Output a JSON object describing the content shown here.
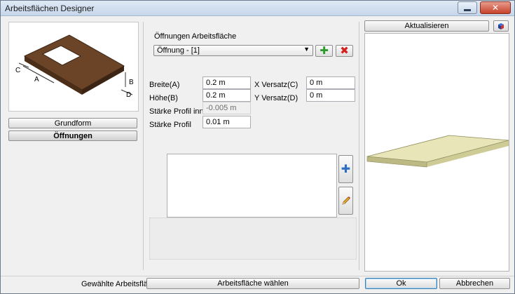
{
  "window": {
    "title": "Arbeitsflächen Designer"
  },
  "left": {
    "diagram_labels": {
      "a": "A",
      "b": "B",
      "c": "C",
      "d": "D"
    },
    "buttons": {
      "grundform": "Grundform",
      "oeffnungen": "Öffnungen"
    }
  },
  "openings": {
    "group_label": "Öffnungen Arbeitsfläche",
    "selected": "Öffnung - [1]"
  },
  "fields": {
    "breite_label": "Breite(A)",
    "breite_value": "0.2 m",
    "hoehe_label": "Höhe(B)",
    "hoehe_value": "0.2 m",
    "staerke_innen_label": "Stärke Profil innen",
    "staerke_innen_value": "-0.005 m",
    "staerke_label": "Stärke Profil",
    "staerke_value": "0.01 m",
    "xversatz_label": "X Versatz(C)",
    "xversatz_value": "0 m",
    "yversatz_label": "Y Versatz(D)",
    "yversatz_value": "0 m"
  },
  "right": {
    "refresh_label": "Aktualisieren"
  },
  "footer": {
    "selected_label": "Gewählte Arbeitsfläche",
    "choose_button": "Arbeitsfläche wählen",
    "ok_button": "Ok",
    "cancel_button": "Abbrechen"
  },
  "colors": {
    "countertop_brown": "#5a3a22",
    "slab_yellow": "#e8e6b8",
    "plus_green": "#2e9a2e",
    "delete_red": "#d62020",
    "add_blue": "#2a6fc0"
  }
}
